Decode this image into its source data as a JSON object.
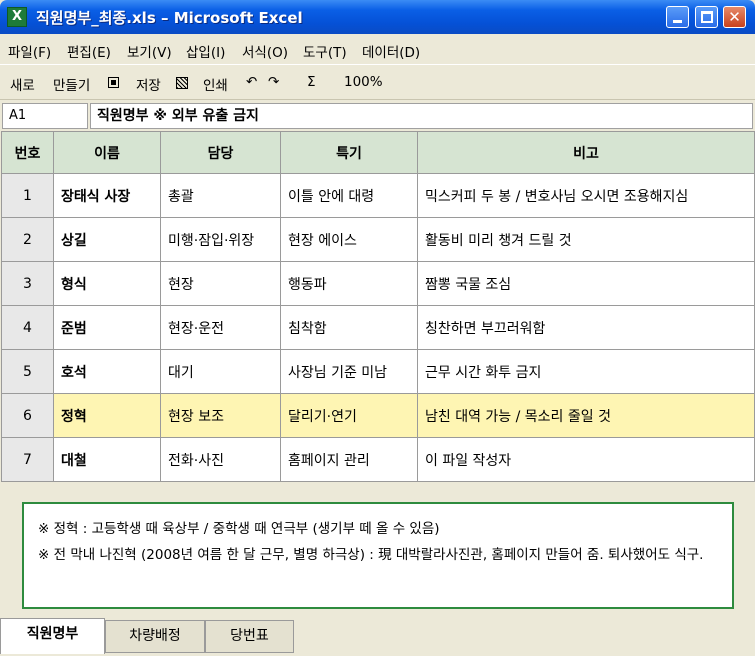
{
  "window": {
    "title": "직원명부_최종.xls – Microsoft Excel",
    "app_icon_letter": "X",
    "controls": {
      "close": "✕"
    }
  },
  "menu": [
    "파일(F)",
    "편집(E)",
    "보기(V)",
    "삽입(I)",
    "서식(O)",
    "도구(T)",
    "데이터(D)"
  ],
  "toolbar": {
    "new": "새로",
    "make": "만들기",
    "save": "저장",
    "print": "인쇄",
    "undo": "↶",
    "redo": "↷",
    "sum": "Σ",
    "zoom": "100%"
  },
  "formula_bar": {
    "cell_ref": "A1",
    "content": "직원명부 ※ 외부 유출 금지"
  },
  "table": {
    "headers": [
      "번호",
      "이름",
      "담당",
      "특기",
      "비고"
    ],
    "rows": [
      {
        "num": "1",
        "name": "장태식 사장",
        "role": "총괄",
        "skill": "이틀 안에 대령",
        "note": "믹스커피 두 봉 / 변호사님 오시면 조용해지심"
      },
      {
        "num": "2",
        "name": "상길",
        "role": "미행·잠입·위장",
        "skill": "현장 에이스",
        "note": "활동비 미리 챙겨 드릴 것"
      },
      {
        "num": "3",
        "name": "형식",
        "role": "현장",
        "skill": "행동파",
        "note": "짬뽕 국물 조심"
      },
      {
        "num": "4",
        "name": "준범",
        "role": "현장·운전",
        "skill": "침착함",
        "note": "칭찬하면 부끄러워함"
      },
      {
        "num": "5",
        "name": "호석",
        "role": "대기",
        "skill": "사장님 기준 미남",
        "note": "근무 시간 화투 금지"
      },
      {
        "num": "6",
        "name": "정혁",
        "role": "현장 보조",
        "skill": "달리기·연기",
        "note": "남친 대역 가능 / 목소리 줄일 것"
      },
      {
        "num": "7",
        "name": "대철",
        "role": "전화·사진",
        "skill": "홈페이지 관리",
        "note": "이 파일 작성자"
      }
    ]
  },
  "notes": [
    "※ 정혁 : 고등학생 때 육상부 / 중학생 때 연극부 (생기부 떼 올 수 있음)",
    "※ 전 막내 나진혁 (2008년 여름 한 달 근무, 별명 하극상) : 現 대박랄라사진관, 홈페이지 만들어 줌. 퇴사했어도 식구."
  ],
  "sheet_tabs": [
    "직원명부",
    "차량배정",
    "당번표"
  ],
  "colors": {
    "header_fill": "#d6e4d2",
    "highlight_row": "#fef5b3",
    "note_border": "#2e8b3e",
    "titlebar": "#0551d6"
  }
}
